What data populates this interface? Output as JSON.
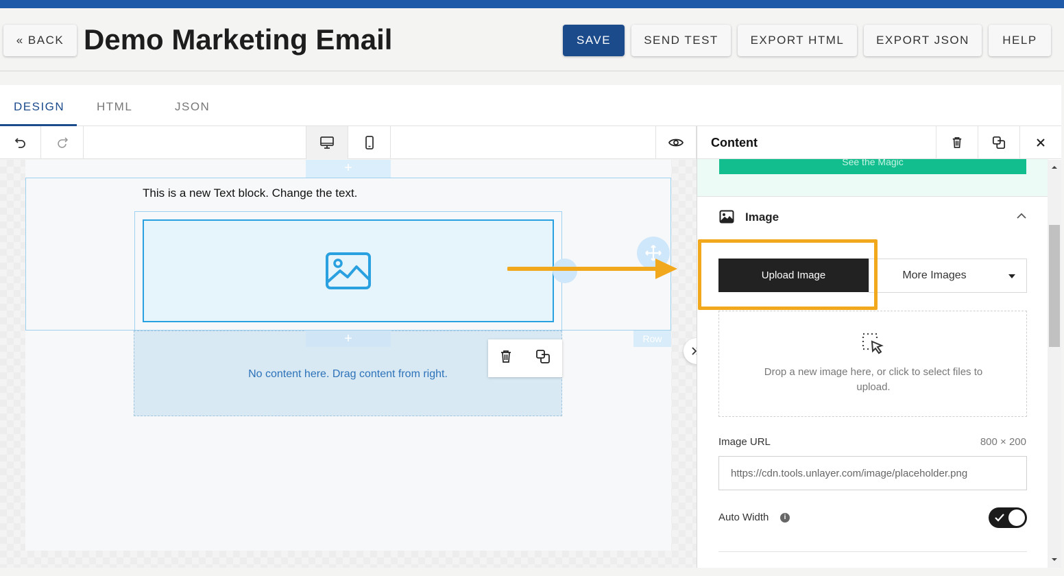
{
  "header": {
    "back_label": "« BACK",
    "title": "Demo Marketing Email",
    "save_label": "SAVE",
    "send_test_label": "SEND TEST",
    "export_html_label": "EXPORT HTML",
    "export_json_label": "EXPORT JSON",
    "help_label": "HELP"
  },
  "tabs": [
    {
      "label": "DESIGN",
      "active": true
    },
    {
      "label": "HTML",
      "active": false
    },
    {
      "label": "JSON",
      "active": false
    }
  ],
  "canvas": {
    "add_glyph": "+",
    "text_block": "This is a new Text block. Change the text.",
    "empty_column_text": "No content here. Drag content from right.",
    "row_badge": "Row"
  },
  "panel": {
    "title": "Content",
    "green_button_label": "See the Magic",
    "image_section_title": "Image",
    "upload_button_label": "Upload Image",
    "more_images_label": "More Images",
    "dropzone_text": "Drop a new image here, or click to select files to upload.",
    "image_url_label": "Image URL",
    "image_size": "800 × 200",
    "image_url_value": "https://cdn.tools.unlayer.com/image/placeholder.png",
    "auto_width_label": "Auto Width",
    "auto_width_on": true,
    "info_glyph": "i"
  },
  "colors": {
    "accent": "#1c4b8c",
    "highlight": "#f2a81d",
    "green": "#12be8e",
    "image_blue": "#29a0e0"
  },
  "icons": [
    "undo-icon",
    "redo-icon",
    "desktop-icon",
    "mobile-icon",
    "eye-icon",
    "trash-icon",
    "duplicate-icon",
    "close-icon",
    "image-icon",
    "chevron-up-icon",
    "caret-down-icon",
    "drop-cursor-icon",
    "move-icon",
    "double-chevron-right-icon",
    "info-icon",
    "check-icon"
  ]
}
